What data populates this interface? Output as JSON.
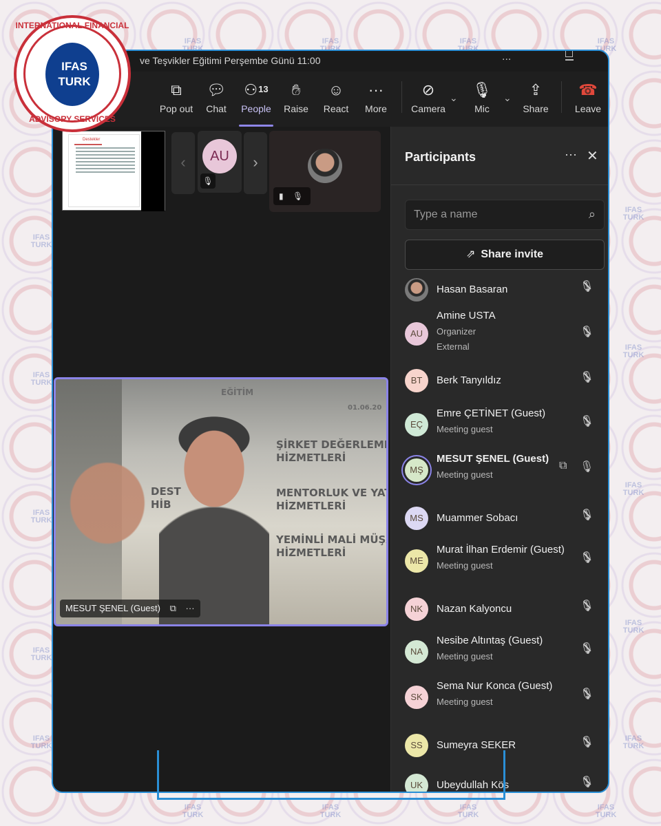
{
  "watermark": {
    "line1": "IFAS",
    "line2": "TURK"
  },
  "logo": {
    "top_text": "INTERNATIONAL FINANCIAL",
    "bottom_text": "ADVISORY SERVICES",
    "line1": "IFAS",
    "line2": "TURK",
    "colors": {
      "red": "#c9303a",
      "blue": "#0f3f8f"
    }
  },
  "window": {
    "title": "ve Teşvikler Eğitimi Perşembe Günü 11:00",
    "title_more": "..."
  },
  "toolbar": {
    "pop_out": "Pop out",
    "chat": "Chat",
    "people": "People",
    "people_count": "13",
    "raise": "Raise",
    "react": "React",
    "more": "More",
    "camera": "Camera",
    "mic": "Mic",
    "share": "Share",
    "leave": "Leave"
  },
  "stage": {
    "au_initials": "AU",
    "main_speaker": "MESUT ŞENEL (Guest)",
    "background_texts": [
      "ŞİRKET DEĞERLEME\nHİZMETLERİ",
      "MENTORLUK VE YATIR\nHİZMETLERİ",
      "YEMİNLİ MALİ MÜŞA\nHİZMETLERİ",
      "DEST\nHİB",
      "EĞİTİM",
      "01.06.20"
    ]
  },
  "participants": {
    "title": "Participants",
    "search_placeholder": "Type a name",
    "share_invite": "Share invite",
    "list": [
      {
        "initials": "",
        "name": "Hasan Basaran",
        "sub1": "",
        "sub2": "",
        "color": "#8a8a8a",
        "photo": true
      },
      {
        "initials": "AU",
        "name": "Amine USTA",
        "sub1": "Organizer",
        "sub2": "External",
        "color": "#e8c7d9"
      },
      {
        "initials": "BT",
        "name": "Berk Tanyıldız",
        "sub1": "",
        "sub2": "",
        "color": "#f7d4cc"
      },
      {
        "initials": "EÇ",
        "name": "Emre ÇETİNET (Guest)",
        "sub1": "Meeting guest",
        "sub2": "",
        "color": "#cfe9d6"
      },
      {
        "initials": "MŞ",
        "name": "MESUT ŞENEL (Guest)",
        "sub1": "Meeting guest",
        "sub2": "",
        "color": "#d6e8c8",
        "speaking": true
      },
      {
        "initials": "MS",
        "name": "Muammer Sobacı",
        "sub1": "",
        "sub2": "",
        "color": "#dcd8f3"
      },
      {
        "initials": "ME",
        "name": "Murat İlhan Erdemir (Guest)",
        "sub1": "Meeting guest",
        "sub2": "",
        "color": "#ece7a8"
      },
      {
        "initials": "NK",
        "name": "Nazan Kalyoncu",
        "sub1": "",
        "sub2": "",
        "color": "#f5d2d6"
      },
      {
        "initials": "NA",
        "name": "Nesibe Altıntaş (Guest)",
        "sub1": "Meeting guest",
        "sub2": "",
        "color": "#d4e8d4"
      },
      {
        "initials": "SK",
        "name": "Sema Nur Konca (Guest)",
        "sub1": "Meeting guest",
        "sub2": "",
        "color": "#f5d2d6"
      },
      {
        "initials": "SS",
        "name": "Sumeyra SEKER",
        "sub1": "",
        "sub2": "",
        "color": "#ece7a8"
      },
      {
        "initials": "UK",
        "name": "Ubeydullah Kös",
        "sub1": "",
        "sub2": "",
        "color": "#d4e8d4"
      }
    ]
  },
  "slide": {
    "title": "Destekler"
  }
}
